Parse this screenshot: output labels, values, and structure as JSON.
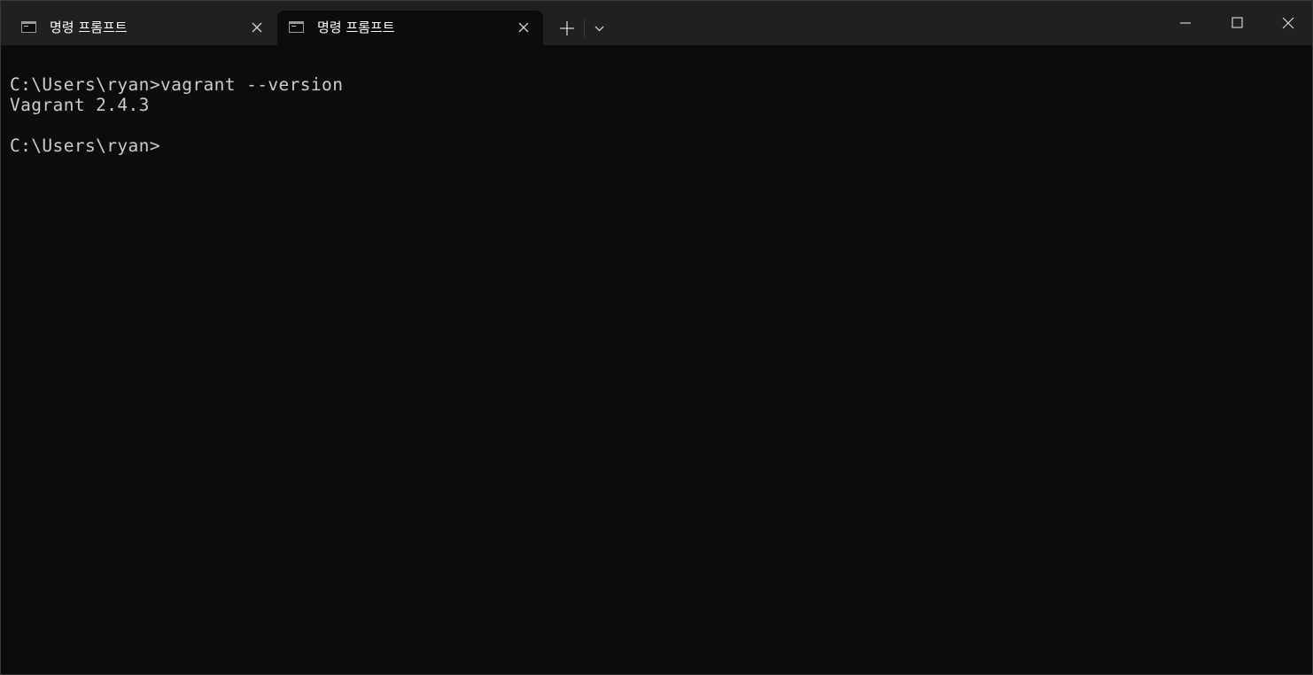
{
  "tabs": [
    {
      "label": "명령 프롬프트",
      "active": false,
      "icon": "command-prompt-icon"
    },
    {
      "label": "명령 프롬프트",
      "active": true,
      "icon": "command-prompt-icon"
    }
  ],
  "toolbar": {
    "new_tab_icon": "plus-icon",
    "dropdown_icon": "chevron-down-icon"
  },
  "window_controls": {
    "minimize_icon": "minimize-icon",
    "maximize_icon": "maximize-icon",
    "close_icon": "close-icon"
  },
  "terminal": {
    "lines": [
      "C:\\Users\\ryan>vagrant --version",
      "Vagrant 2.4.3",
      "",
      "C:\\Users\\ryan>"
    ]
  },
  "colors": {
    "titlebar_bg": "#202020",
    "terminal_bg": "#0c0c0c",
    "terminal_fg": "#cccccc",
    "tab_text": "#ffffff"
  }
}
